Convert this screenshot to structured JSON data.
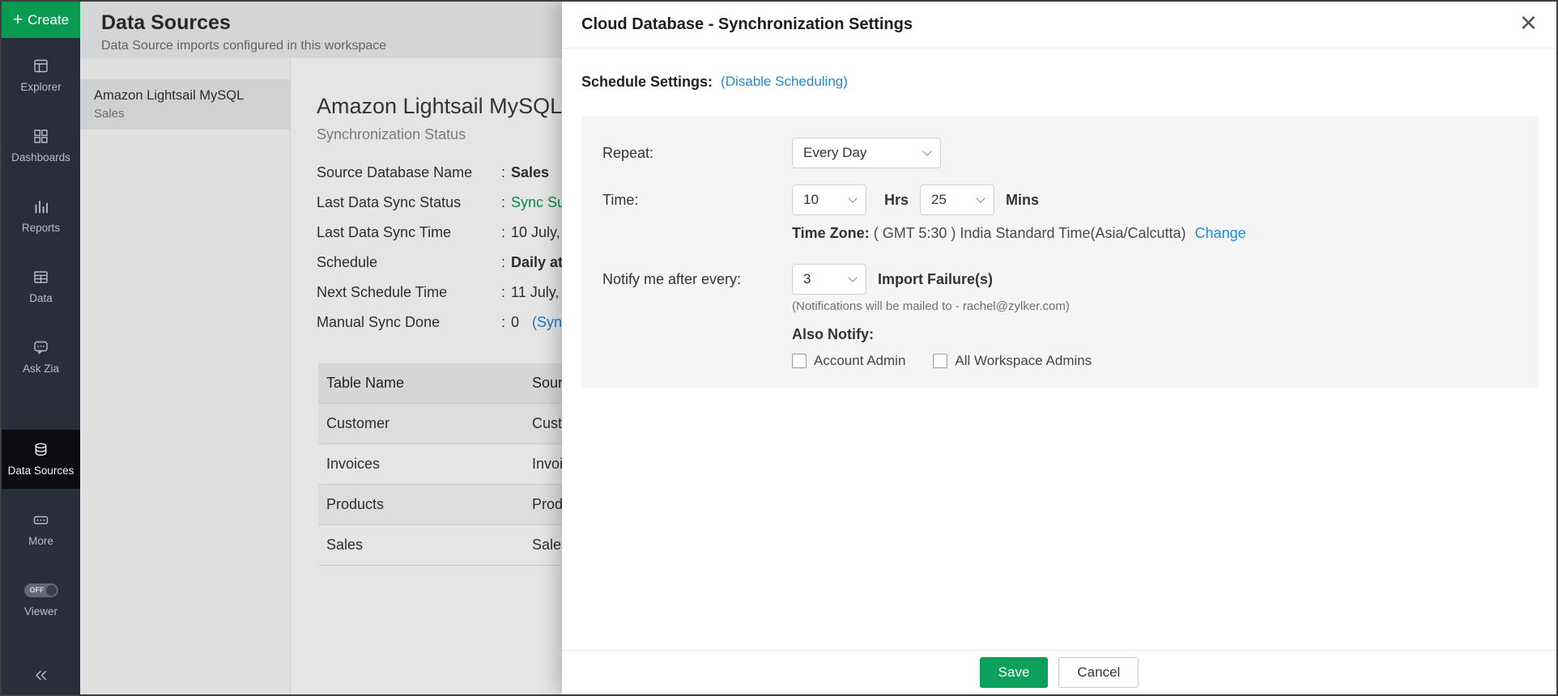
{
  "colors": {
    "sidebar_bg": "#2a2d3c",
    "create_green": "#0a9b53",
    "link_blue": "#2089d5",
    "save_green": "#0da05c",
    "sync_status_green": "#0a9b53"
  },
  "sidebar": {
    "create_label": "Create",
    "create_plus": "+",
    "viewer_off": "OFF",
    "items": [
      {
        "label": "Explorer"
      },
      {
        "label": "Dashboards"
      },
      {
        "label": "Reports"
      },
      {
        "label": "Data"
      },
      {
        "label": "Ask Zia"
      },
      {
        "label": "Data Sources"
      },
      {
        "label": "More"
      },
      {
        "label": "Viewer"
      }
    ]
  },
  "page": {
    "title": "Data Sources",
    "subtitle": "Data Source imports configured in this workspace"
  },
  "source_list": {
    "selected": {
      "title": "Amazon Lightsail MySQL",
      "subtitle": "Sales"
    }
  },
  "detail": {
    "title": "Amazon Lightsail MySQL",
    "section": "Synchronization Status",
    "colon": ":",
    "rows": [
      {
        "label": "Source Database Name",
        "value": "Sales"
      },
      {
        "label": "Last Data Sync Status",
        "value": "Sync Su"
      },
      {
        "label": "Last Data Sync Time",
        "value": "10 July,"
      },
      {
        "label": "Schedule",
        "value": "Daily at"
      },
      {
        "label": "Next Schedule Time",
        "value": "11 July,"
      },
      {
        "label": "Manual Sync Done",
        "value": "0",
        "link": "(Syn"
      }
    ],
    "table": {
      "header": [
        "Table Name",
        "Sourc"
      ],
      "rows": [
        [
          "Customer",
          "Cust"
        ],
        [
          "Invoices",
          "Invoi"
        ],
        [
          "Products",
          "Prod"
        ],
        [
          "Sales",
          "Sales"
        ]
      ]
    }
  },
  "modal": {
    "title": "Cloud Database - Synchronization Settings",
    "close_glyph": "×",
    "schedule_settings_label": "Schedule Settings:",
    "disable_scheduling_link": "(Disable Scheduling)",
    "repeat": {
      "label": "Repeat:",
      "value": "Every Day"
    },
    "time": {
      "label": "Time:",
      "hours": "10",
      "hours_unit": "Hrs",
      "minutes": "25",
      "minutes_unit": "Mins"
    },
    "timezone": {
      "label": "Time Zone:",
      "value": "( GMT 5:30 ) India Standard Time(Asia/Calcutta)",
      "change_link": "Change"
    },
    "notify": {
      "label": "Notify me after every:",
      "value": "3",
      "unit": "Import Failure(s)",
      "note": "(Notifications will be mailed to - rachel@zylker.com)"
    },
    "also_notify_label": "Also Notify:",
    "checkboxes": [
      {
        "label": "Account Admin",
        "checked": false
      },
      {
        "label": "All Workspace Admins",
        "checked": false
      }
    ],
    "save_label": "Save",
    "cancel_label": "Cancel"
  }
}
